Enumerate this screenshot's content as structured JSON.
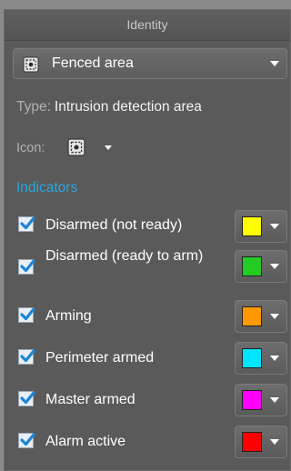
{
  "header": {
    "title": "Identity"
  },
  "entity_dropdown": {
    "value": "Fenced area",
    "icon": "fenced-area-icon"
  },
  "type_row": {
    "label": "Type:",
    "value": "Intrusion detection area"
  },
  "icon_row": {
    "label": "Icon:",
    "icon": "fenced-area-icon"
  },
  "states_section": {
    "title": "Indicators"
  },
  "states": [
    {
      "label": "Disarmed (not ready)",
      "checked": true,
      "color": "#ffff00"
    },
    {
      "label": "Disarmed (ready to arm)",
      "checked": true,
      "color": "#22cc22"
    },
    {
      "label": "Arming",
      "checked": true,
      "color": "#ff9900"
    },
    {
      "label": "Perimeter armed",
      "checked": true,
      "color": "#00e5ff"
    },
    {
      "label": "Master armed",
      "checked": true,
      "color": "#ff00ff"
    },
    {
      "label": "Alarm active",
      "checked": true,
      "color": "#ff0000"
    }
  ]
}
